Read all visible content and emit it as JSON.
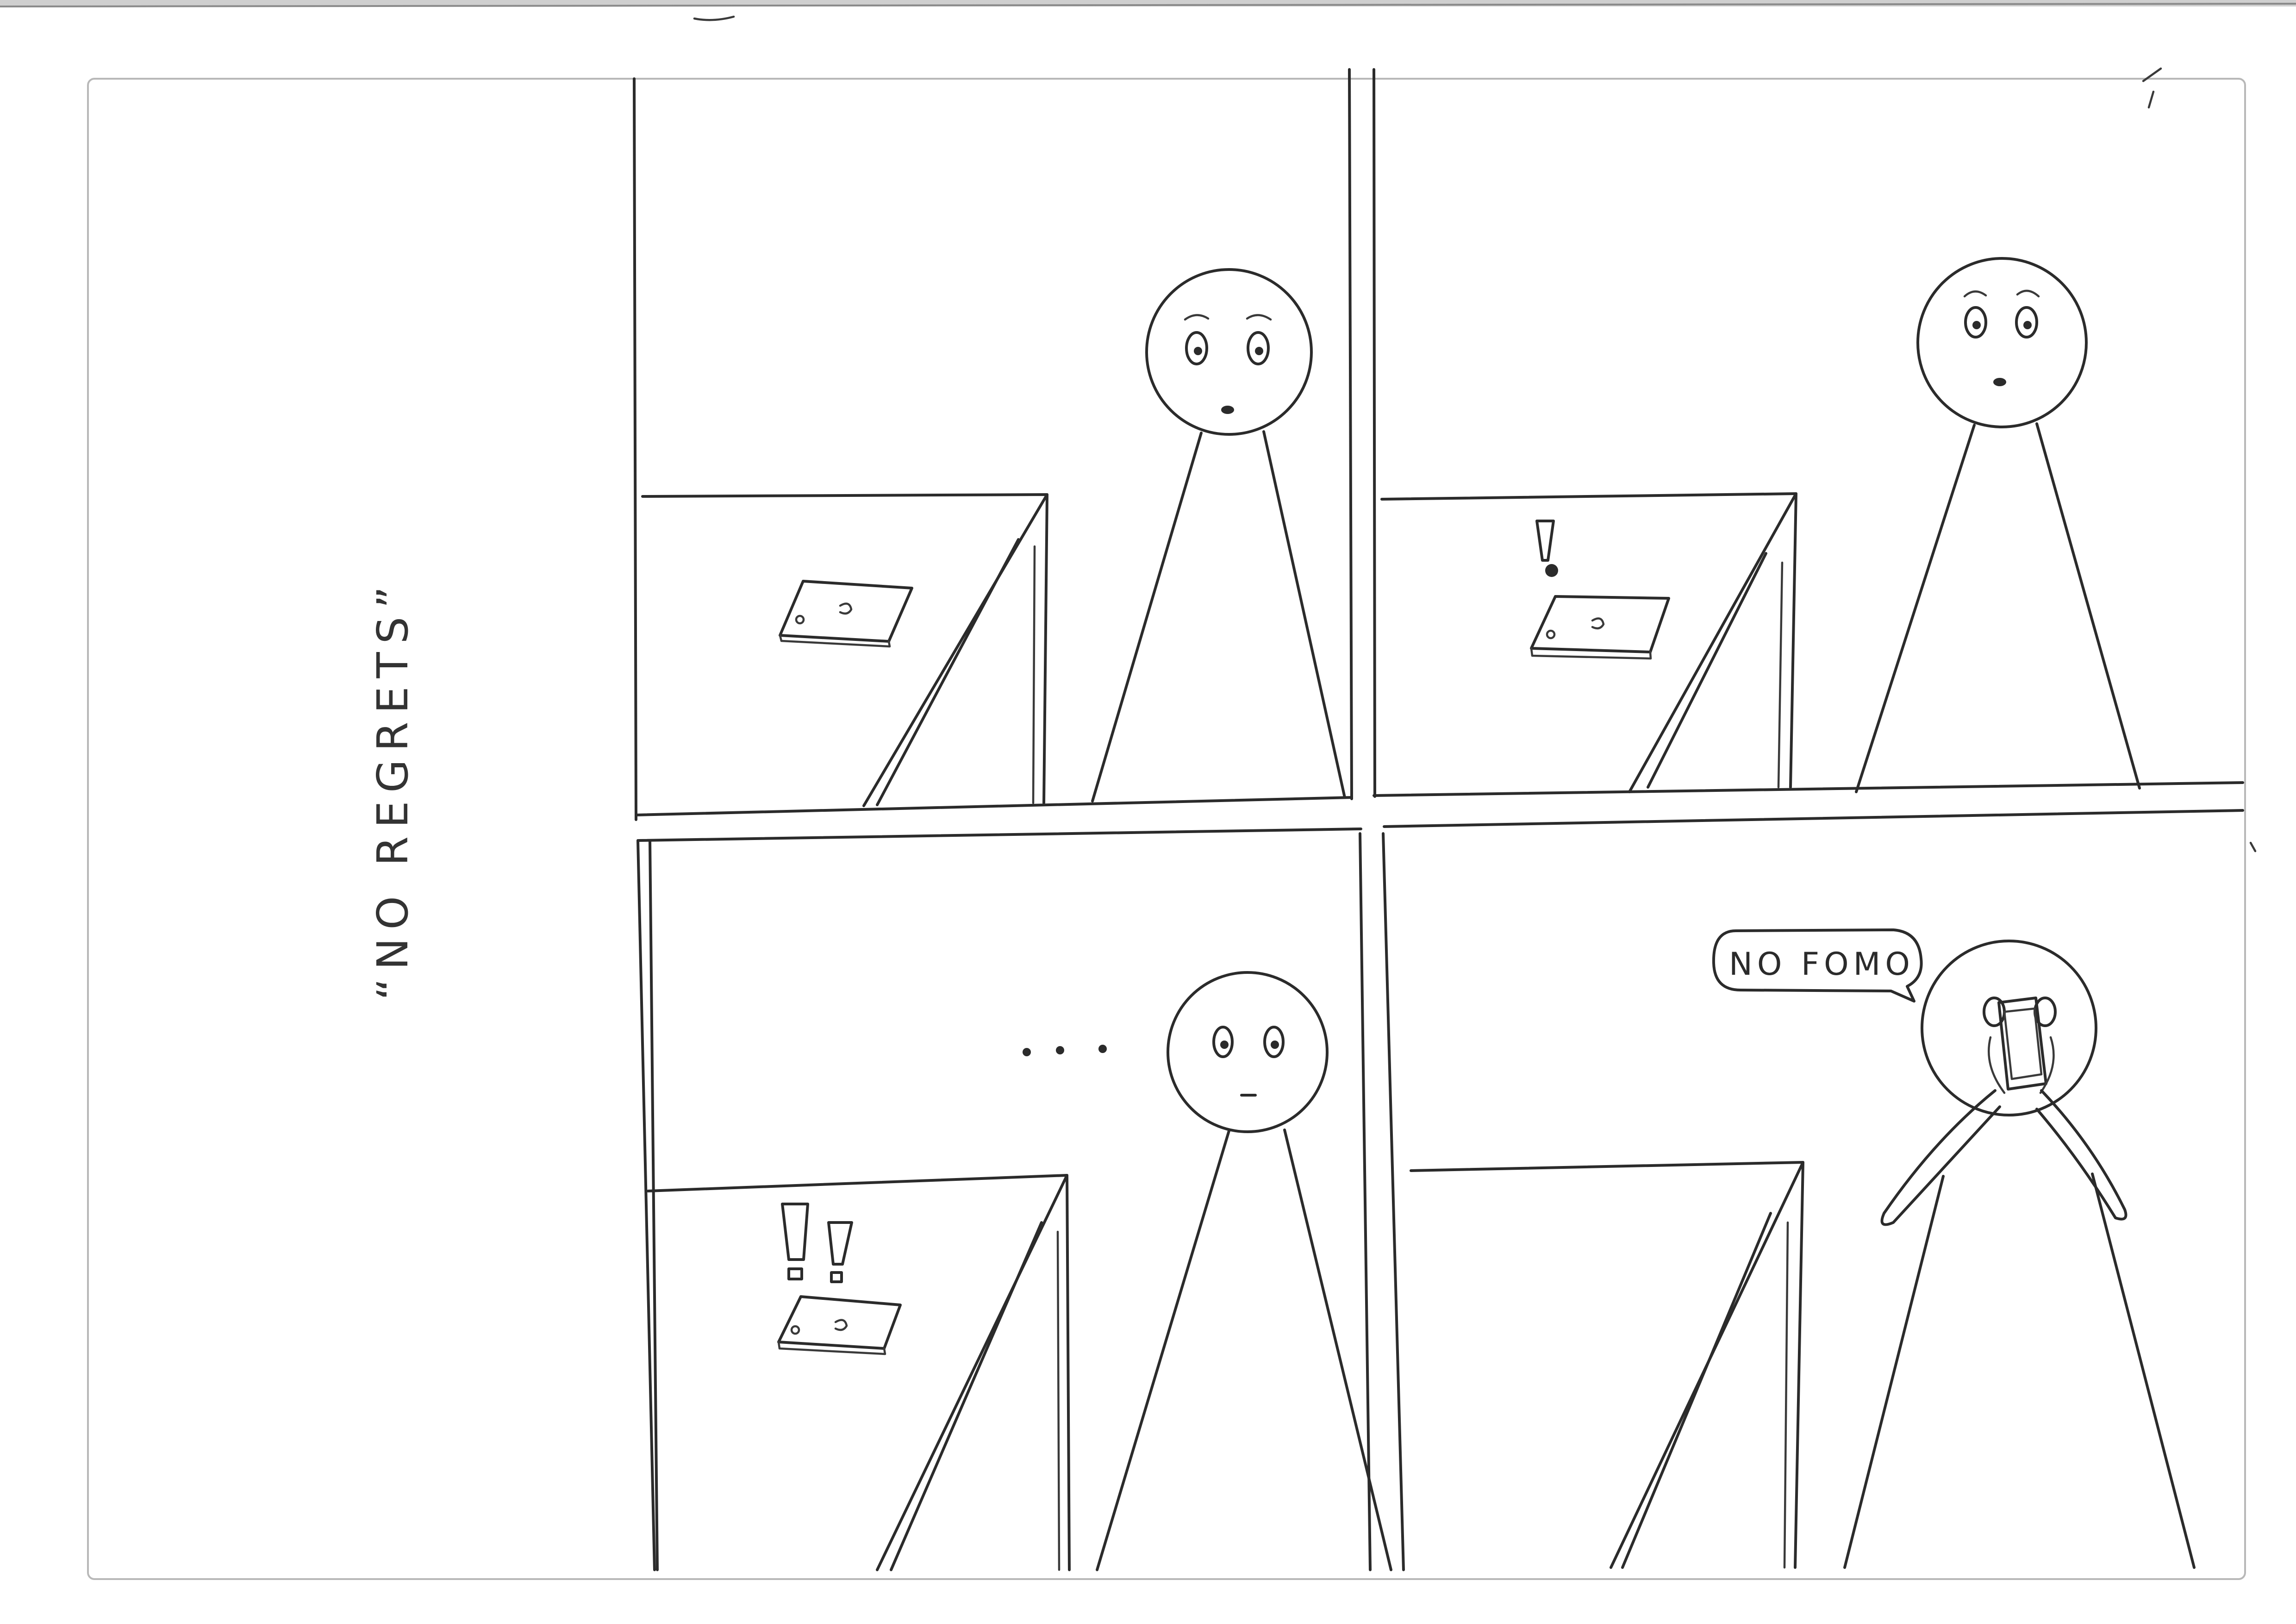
{
  "comic": {
    "title": "“NO REGRETS”",
    "speech_bubble": "NO FOMO",
    "ellipsis": "• • •",
    "alert_single": "!",
    "alert_double": "! !"
  },
  "colors": {
    "paper": "#ffffff",
    "pencil": "#2b2b2b"
  }
}
